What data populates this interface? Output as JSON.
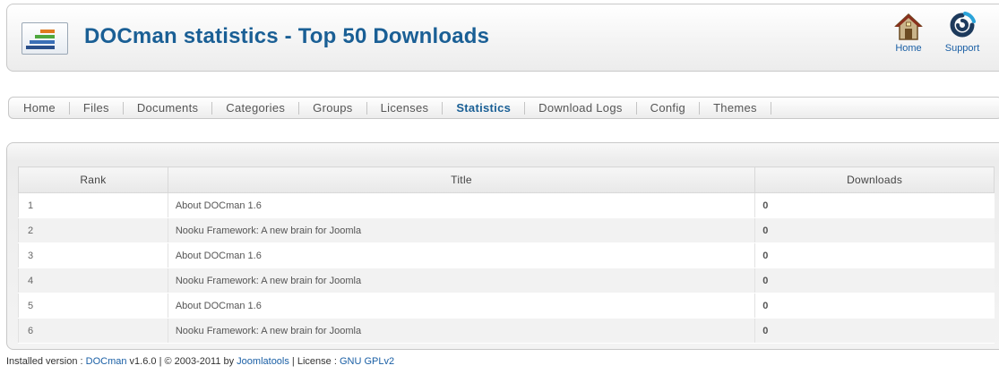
{
  "header": {
    "title": "DOCman statistics - Top 50 Downloads",
    "buttons": [
      {
        "label": "Home",
        "icon": "home-icon"
      },
      {
        "label": "Support",
        "icon": "support-icon"
      }
    ]
  },
  "nav": {
    "items": [
      {
        "label": "Home",
        "active": false
      },
      {
        "label": "Files",
        "active": false
      },
      {
        "label": "Documents",
        "active": false
      },
      {
        "label": "Categories",
        "active": false
      },
      {
        "label": "Groups",
        "active": false
      },
      {
        "label": "Licenses",
        "active": false
      },
      {
        "label": "Statistics",
        "active": true
      },
      {
        "label": "Download Logs",
        "active": false
      },
      {
        "label": "Config",
        "active": false
      },
      {
        "label": "Themes",
        "active": false
      }
    ]
  },
  "table": {
    "headers": [
      "Rank",
      "Title",
      "Downloads"
    ],
    "rows": [
      {
        "rank": "1",
        "title": "About DOCman 1.6",
        "downloads": "0"
      },
      {
        "rank": "2",
        "title": "Nooku Framework: A new brain for Joomla",
        "downloads": "0"
      },
      {
        "rank": "3",
        "title": "About DOCman 1.6",
        "downloads": "0"
      },
      {
        "rank": "4",
        "title": "Nooku Framework: A new brain for Joomla",
        "downloads": "0"
      },
      {
        "rank": "5",
        "title": "About DOCman 1.6",
        "downloads": "0"
      },
      {
        "rank": "6",
        "title": "Nooku Framework: A new brain for Joomla",
        "downloads": "0"
      }
    ]
  },
  "footer": {
    "prefix": "Installed version : ",
    "product_link": "DOCman",
    "version_text": " v1.6.0 | © 2003-2011 by ",
    "vendor_link": "Joomlatools",
    "license_text": " | License : ",
    "license_link": "GNU GPLv2"
  },
  "colors": {
    "title": "#1a5f95",
    "link": "#1a5fa5",
    "active_tab": "#1a5f95"
  }
}
